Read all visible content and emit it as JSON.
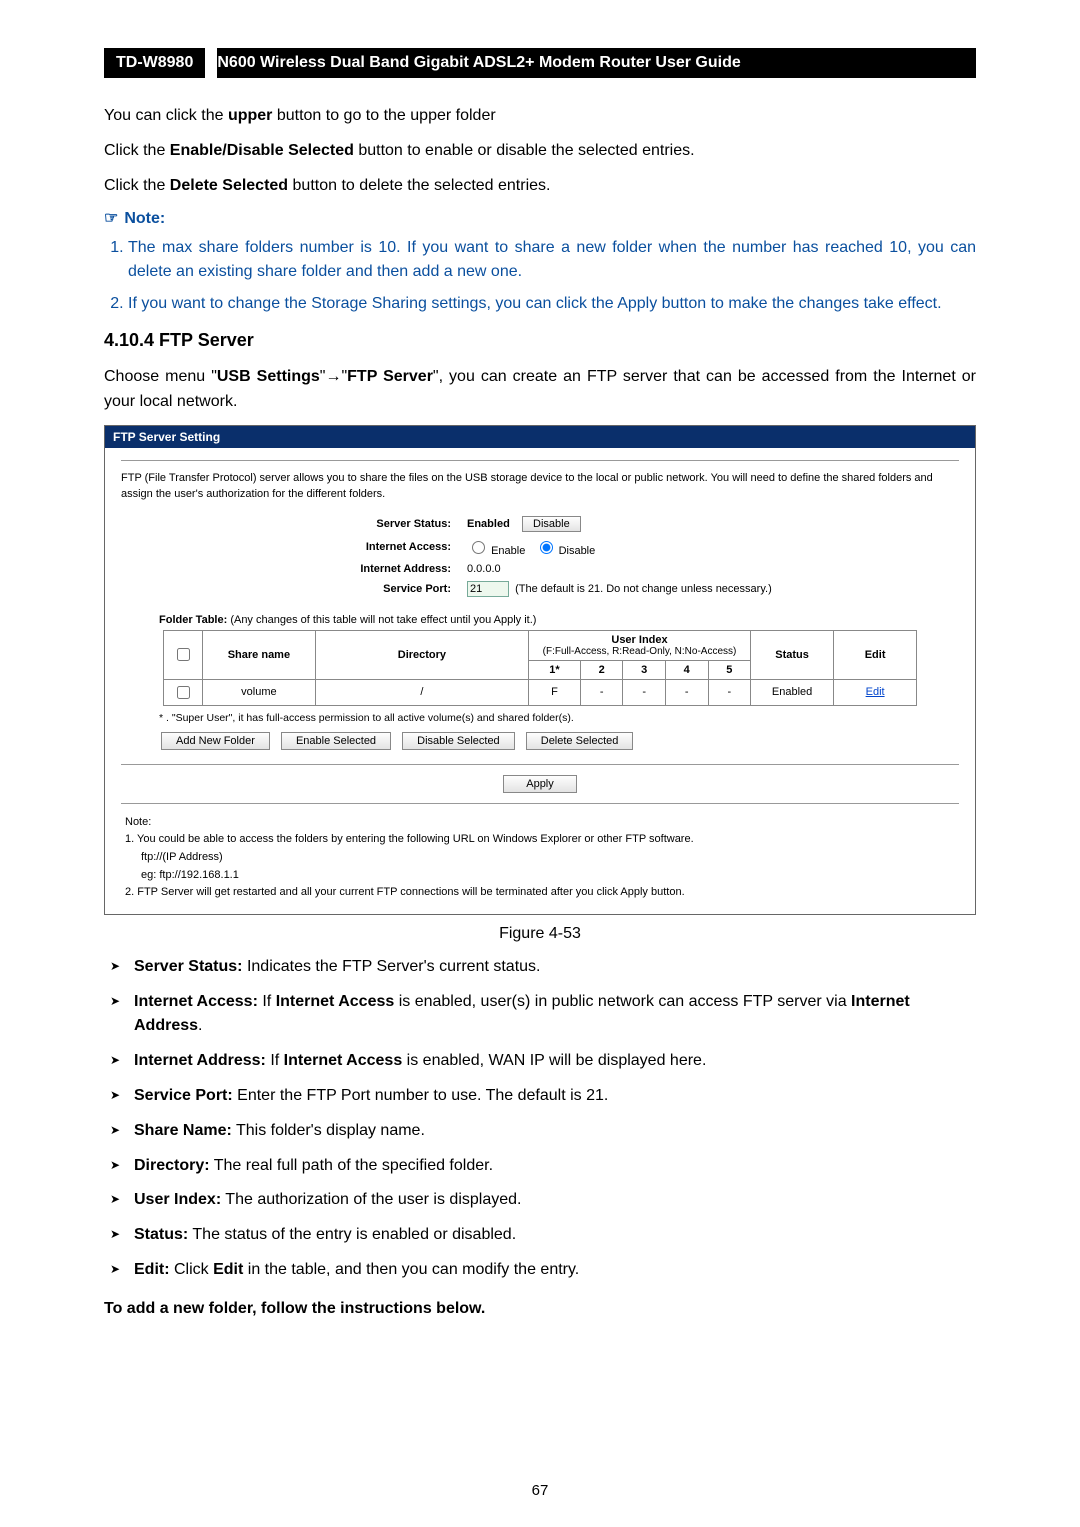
{
  "header": {
    "model": "TD-W8980",
    "title": "N600 Wireless Dual Band Gigabit ADSL2+ Modem Router User Guide"
  },
  "body": {
    "p1_a": "You can click the ",
    "p1_b": "upper",
    "p1_c": " button to go to the upper folder",
    "p2_a": "Click the ",
    "p2_b": "Enable/Disable Selected",
    "p2_c": " button to enable or disable the selected entries.",
    "p3_a": "Click the ",
    "p3_b": "Delete Selected",
    "p3_c": " button to delete the selected entries."
  },
  "note": {
    "icon": "☞",
    "label": "Note:",
    "items": [
      "The max share folders number is 10. If you want to share a new folder when the number has reached 10, you can delete an existing share folder and then add a new one.",
      "If you want to change the Storage Sharing settings, you can click the Apply button to make the changes take effect."
    ]
  },
  "section": {
    "heading": "4.10.4 FTP Server",
    "para_a": "Choose menu \"",
    "para_b": "USB Settings",
    "para_c": "\"→\"",
    "para_d": "FTP Server",
    "para_e": "\", you can create an FTP server that can be accessed from the Internet or your local network."
  },
  "ftp": {
    "title": "FTP Server Setting",
    "intro": "FTP (File Transfer Protocol) server allows you to share the files on the USB storage device to the local or public network. You will need to define the shared folders and assign the user's authorization for the different folders.",
    "labels": {
      "server_status": "Server Status:",
      "internet_access": "Internet Access:",
      "internet_address": "Internet Address:",
      "service_port": "Service Port:"
    },
    "values": {
      "server_status": "Enabled",
      "disable_btn": "Disable",
      "enable_opt": "Enable",
      "disable_opt": "Disable",
      "internet_address": "0.0.0.0",
      "port": "21",
      "port_hint": "(The default is 21. Do not change unless necessary.)"
    },
    "folder_title_a": "Folder Table: ",
    "folder_title_b": "(Any changes of this table will not take effect until you Apply it.)",
    "table": {
      "h_share": "Share name",
      "h_dir": "Directory",
      "h_user_index": "User Index",
      "h_user_hint": "(F:Full-Access, R:Read-Only, N:No-Access)",
      "h_status": "Status",
      "h_edit": "Edit",
      "cols": [
        "1*",
        "2",
        "3",
        "4",
        "5"
      ],
      "row": {
        "share": "volume",
        "dir": "/",
        "v1": "F",
        "v2": "-",
        "v3": "-",
        "v4": "-",
        "v5": "-",
        "status": "Enabled",
        "edit": "Edit"
      }
    },
    "super_note": "* . \"Super User\", it has full-access permission to all active volume(s) and shared folder(s).",
    "buttons": {
      "add": "Add New Folder",
      "enable": "Enable Selected",
      "disable": "Disable Selected",
      "delete": "Delete Selected",
      "apply": "Apply"
    },
    "notes": {
      "heading": "Note:",
      "n1": "1. You could be able to access the folders by entering the following URL on Windows Explorer or other FTP software.",
      "n1a": "ftp://(IP Address)",
      "n1b": "eg: ftp://192.168.1.1",
      "n2": "2. FTP Server will get restarted and all your current FTP connections will be terminated after you click Apply button."
    }
  },
  "figcap": "Figure 4-53",
  "bullets": [
    {
      "b": "Server Status:",
      "t": " Indicates the FTP Server's current status."
    },
    {
      "b": "Internet Access:",
      "t_a": " If ",
      "t_b": "Internet Access",
      "t_c": " is enabled, user(s) in public network can access FTP server via ",
      "t_d": "Internet Address",
      "t_e": "."
    },
    {
      "b": "Internet Address:",
      "t_a": " If ",
      "t_b": "Internet Access",
      "t_c": " is enabled, WAN IP will be displayed here."
    },
    {
      "b": "Service Port:",
      "t": " Enter the FTP Port number to use. The default is 21."
    },
    {
      "b": "Share Name:",
      "t": " This folder's display name."
    },
    {
      "b": "Directory:",
      "t": " The real full path of the specified folder."
    },
    {
      "b": "User Index:",
      "t": " The authorization of the user is displayed."
    },
    {
      "b": "Status:",
      "t": " The status of the entry is enabled or disabled."
    },
    {
      "b": "Edit:",
      "t_a": " Click ",
      "t_b": "Edit",
      "t_c": " in the table, and then you can modify the entry."
    }
  ],
  "tail": "To add a new folder, follow the instructions below.",
  "page_number": "67"
}
